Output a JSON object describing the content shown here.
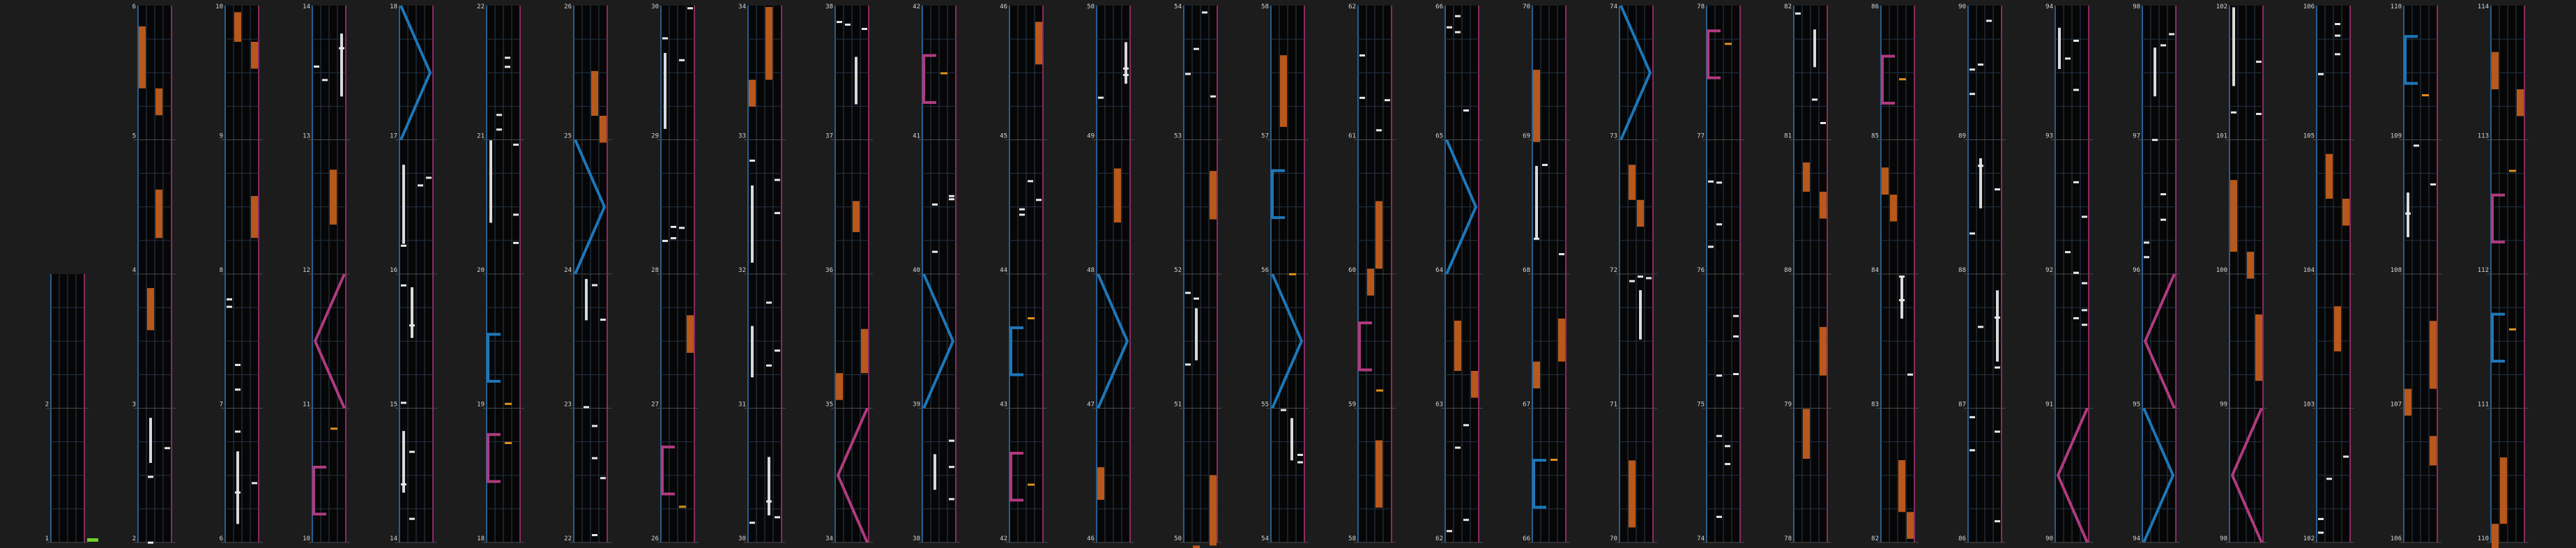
{
  "chart": {
    "measures_per_column": 4,
    "lane_count": 4,
    "first_measure": 1,
    "last_measure": 114,
    "colors": {
      "background": "#1c1c1c",
      "lane_bg": "#060606",
      "grid": "#2b3f52",
      "beat_line": "#243344",
      "border_left": "#2f78b8",
      "border_right": "#b0357e",
      "tap_note": "#e8e8e8",
      "long_note": "#d9d9d9",
      "hold_block": "#b8581b",
      "laser_blue": "#1d77b8",
      "laser_pink": "#b03a7f",
      "chip_fx": "#e2911a",
      "marker_green": "#6ecf2a",
      "label": "#d6d6d6"
    }
  },
  "columns": [
    {
      "top_label": "",
      "labels": [
        "",
        "",
        "2",
        "1"
      ]
    },
    {
      "top_label": "6",
      "labels": [
        "5",
        "4",
        "3",
        "2"
      ]
    },
    {
      "top_label": "10",
      "labels": [
        "9",
        "8",
        "7",
        "6"
      ]
    },
    {
      "top_label": "14",
      "labels": [
        "13",
        "12",
        "11",
        "10"
      ]
    },
    {
      "top_label": "18",
      "labels": [
        "17",
        "16",
        "15",
        "14"
      ]
    },
    {
      "top_label": "22",
      "labels": [
        "21",
        "20",
        "19",
        "18"
      ]
    },
    {
      "top_label": "26",
      "labels": [
        "25",
        "24",
        "23",
        "22"
      ]
    },
    {
      "top_label": "30",
      "labels": [
        "29",
        "28",
        "27",
        "26"
      ]
    },
    {
      "top_label": "34",
      "labels": [
        "33",
        "32",
        "31",
        "30"
      ]
    },
    {
      "top_label": "38",
      "labels": [
        "37",
        "36",
        "35",
        "34"
      ]
    },
    {
      "top_label": "42",
      "labels": [
        "41",
        "40",
        "39",
        "38"
      ]
    },
    {
      "top_label": "46",
      "labels": [
        "45",
        "44",
        "43",
        "42"
      ]
    },
    {
      "top_label": "50",
      "labels": [
        "49",
        "48",
        "47",
        "46"
      ]
    },
    {
      "top_label": "54",
      "labels": [
        "53",
        "52",
        "51",
        "50"
      ]
    },
    {
      "top_label": "58",
      "labels": [
        "57",
        "56",
        "55",
        "54"
      ]
    },
    {
      "top_label": "62",
      "labels": [
        "61",
        "60",
        "59",
        "58"
      ]
    },
    {
      "top_label": "66",
      "labels": [
        "65",
        "64",
        "63",
        "62"
      ]
    },
    {
      "top_label": "70",
      "labels": [
        "69",
        "68",
        "67",
        "66"
      ]
    },
    {
      "top_label": "74",
      "labels": [
        "73",
        "72",
        "71",
        "70"
      ]
    },
    {
      "top_label": "78",
      "labels": [
        "77",
        "76",
        "75",
        "74"
      ]
    },
    {
      "top_label": "82",
      "labels": [
        "81",
        "80",
        "79",
        "78"
      ]
    },
    {
      "top_label": "86",
      "labels": [
        "85",
        "84",
        "83",
        "82"
      ]
    },
    {
      "top_label": "90",
      "labels": [
        "89",
        "88",
        "87",
        "86"
      ]
    },
    {
      "top_label": "94",
      "labels": [
        "93",
        "92",
        "91",
        "90"
      ]
    },
    {
      "top_label": "98",
      "labels": [
        "97",
        "96",
        "95",
        "94"
      ]
    },
    {
      "top_label": "102",
      "labels": [
        "101",
        "100",
        "99",
        "98"
      ]
    },
    {
      "top_label": "106",
      "labels": [
        "105",
        "104",
        "103",
        "102"
      ]
    },
    {
      "top_label": "110",
      "labels": [
        "109",
        "108",
        "107",
        "106"
      ]
    },
    {
      "top_label": "114",
      "labels": [
        "113",
        "112",
        "111",
        "110"
      ]
    }
  ]
}
